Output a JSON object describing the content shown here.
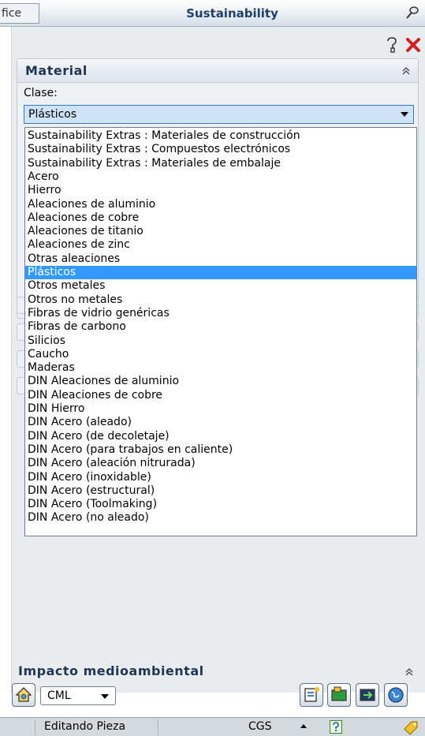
{
  "window": {
    "left_tab": "fice",
    "title": "Sustainability"
  },
  "material": {
    "section_title": "Material",
    "class_label": "Clase:",
    "selected_class": "Plásticos",
    "options": [
      "Sustainability Extras : Materiales de construcción",
      "Sustainability Extras : Compuestos electrónicos",
      "Sustainability Extras : Materiales de embalaje",
      "Acero",
      "Hierro",
      "Aleaciones de aluminio",
      "Aleaciones de cobre",
      "Aleaciones de titanio",
      "Aleaciones de zinc",
      "Otras aleaciones",
      "Plásticos",
      "Otros metales",
      "Otros no metales",
      "Fibras de vidrio genéricas",
      "Fibras de carbono",
      "Silicios",
      "Caucho",
      "Maderas",
      "DIN Aleaciones de aluminio",
      "DIN Aleaciones de cobre",
      "DIN Hierro",
      "DIN Acero (aleado)",
      "DIN Acero (de decoletaje)",
      "DIN Acero (para trabajos en caliente)",
      "DIN Acero (aleación nitrurada)",
      "DIN Acero (inoxidable)",
      "DIN Acero (estructural)",
      "DIN Acero (Toolmaking)",
      "DIN Acero (no aleado)"
    ],
    "selected_index": 10
  },
  "impact": {
    "section_title": "Impacto medioambiental",
    "method_value": "CML"
  },
  "statusbar": {
    "mode": "Editando Pieza",
    "units": "CGS"
  },
  "colors": {
    "selection": "#3399ff",
    "title_text": "#1f3f6a",
    "close_red": "#d61f1f"
  },
  "icons": [
    "pin-icon",
    "help-icon",
    "close-icon",
    "collapse-icon",
    "home-icon",
    "report-icon",
    "export-icon",
    "import-icon",
    "globe-icon",
    "tag-icon"
  ]
}
